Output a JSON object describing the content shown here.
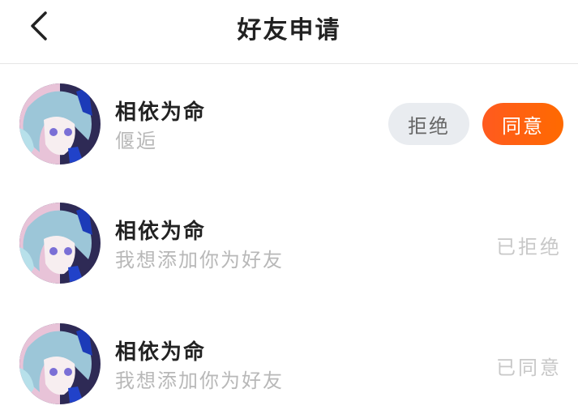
{
  "header": {
    "back_icon": "chevron-left-icon",
    "title": "好友申请"
  },
  "requests": [
    {
      "name": "相依为命",
      "message": "偃逅",
      "reject_label": "拒绝",
      "accept_label": "同意",
      "status": ""
    },
    {
      "name": "相依为命",
      "message": "我想添加你为好友",
      "status": "已拒绝"
    },
    {
      "name": "相依为命",
      "message": "我想添加你为好友",
      "status": "已同意"
    }
  ],
  "colors": {
    "accent": "#ff5f14",
    "reject_bg": "#e9ecf0",
    "muted_text": "#b8b8b8",
    "status_text": "#c8c8c8"
  }
}
